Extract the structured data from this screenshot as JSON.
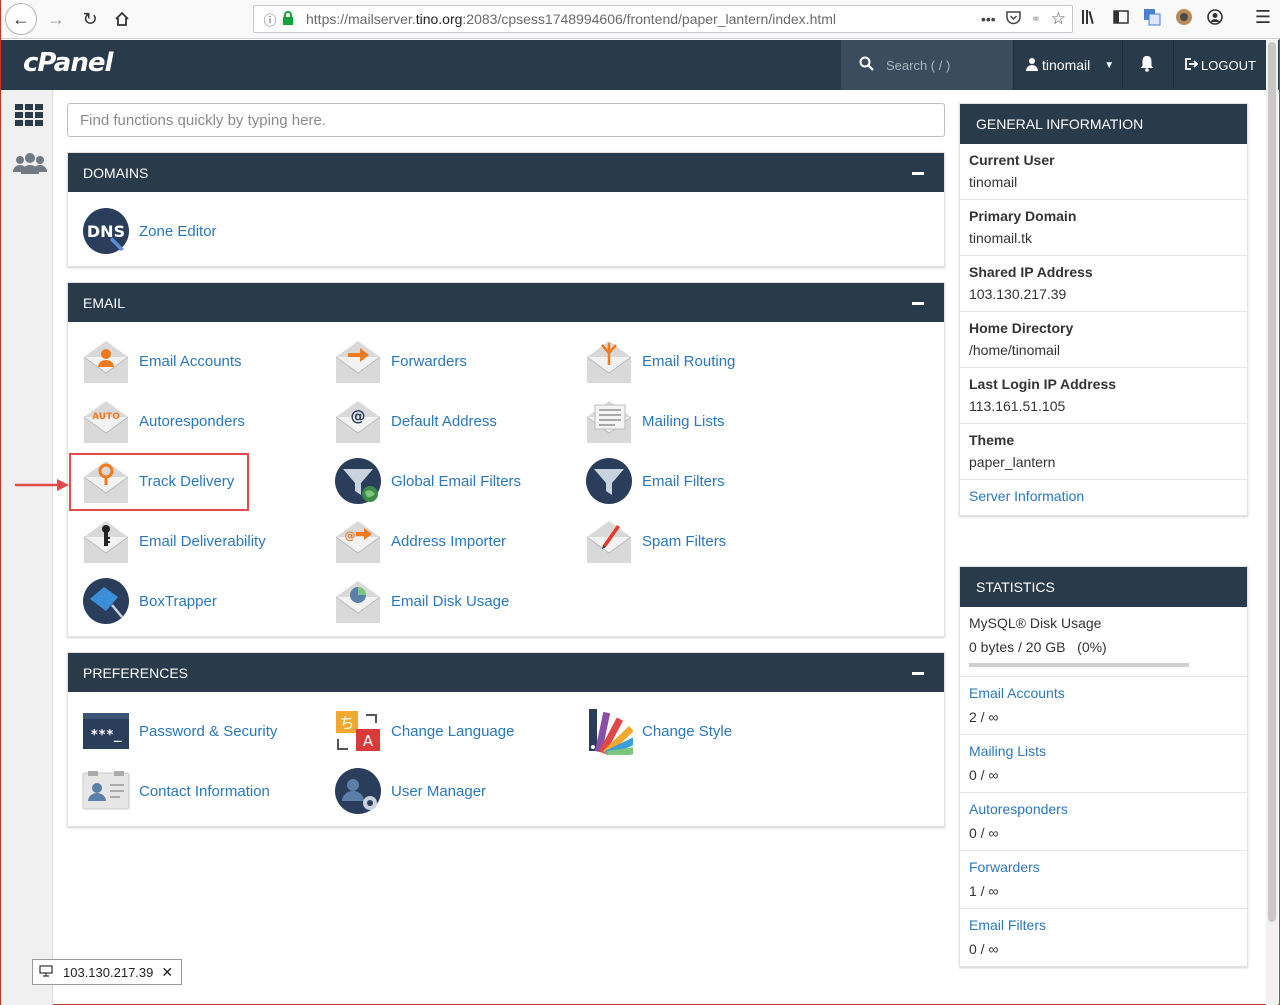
{
  "browser": {
    "url_prefix": "https://mailserver.",
    "url_host": "tino.org",
    "url_rest": ":2083/cpsess1748994606/frontend/paper_lantern/index.html",
    "dots": "•••"
  },
  "header": {
    "logo": "cPanel",
    "search_placeholder": "Search ( / )",
    "user": "tinomail",
    "logout": "LOGOUT"
  },
  "main": {
    "search_placeholder": "Find functions quickly by typing here.",
    "domains": {
      "title": "DOMAINS",
      "items": [
        {
          "label": "Zone Editor",
          "icon": "dns-icon"
        }
      ]
    },
    "email": {
      "title": "EMAIL",
      "items": [
        {
          "label": "Email Accounts",
          "icon": "email-accounts-icon"
        },
        {
          "label": "Forwarders",
          "icon": "forwarders-icon"
        },
        {
          "label": "Email Routing",
          "icon": "email-routing-icon"
        },
        {
          "label": "Autoresponders",
          "icon": "autoresponders-icon"
        },
        {
          "label": "Default Address",
          "icon": "default-address-icon"
        },
        {
          "label": "Mailing Lists",
          "icon": "mailing-lists-icon"
        },
        {
          "label": "Track Delivery",
          "icon": "track-delivery-icon"
        },
        {
          "label": "Global Email Filters",
          "icon": "global-filter-icon"
        },
        {
          "label": "Email Filters",
          "icon": "email-filter-icon"
        },
        {
          "label": "Email Deliverability",
          "icon": "email-deliverability-icon"
        },
        {
          "label": "Address Importer",
          "icon": "address-importer-icon"
        },
        {
          "label": "Spam Filters",
          "icon": "spam-filters-icon"
        },
        {
          "label": "BoxTrapper",
          "icon": "boxtrapper-icon"
        },
        {
          "label": "Email Disk Usage",
          "icon": "email-disk-usage-icon"
        }
      ],
      "auto_badge": "AUTO"
    },
    "preferences": {
      "title": "PREFERENCES",
      "items": [
        {
          "label": "Password & Security",
          "icon": "password-icon"
        },
        {
          "label": "Change Language",
          "icon": "language-icon"
        },
        {
          "label": "Change Style",
          "icon": "style-icon"
        },
        {
          "label": "Contact Information",
          "icon": "contact-icon"
        },
        {
          "label": "User Manager",
          "icon": "user-manager-icon"
        }
      ],
      "password_glyph": "***_"
    }
  },
  "general_info": {
    "title": "GENERAL INFORMATION",
    "rows": [
      {
        "k": "Current User",
        "v": "tinomail"
      },
      {
        "k": "Primary Domain",
        "v": "tinomail.tk"
      },
      {
        "k": "Shared IP Address",
        "v": "103.130.217.39"
      },
      {
        "k": "Home Directory",
        "v": "/home/tinomail"
      },
      {
        "k": "Last Login IP Address",
        "v": "113.161.51.105"
      },
      {
        "k": "Theme",
        "v": "paper_lantern"
      }
    ],
    "server_info": "Server Information"
  },
  "statistics": {
    "title": "STATISTICS",
    "mysql_label": "MySQL® Disk Usage",
    "mysql_value": "0 bytes / 20 GB   (0%)",
    "mysql_fraction": 0,
    "rows": [
      {
        "k": "Email Accounts",
        "v": "2 / ∞"
      },
      {
        "k": "Mailing Lists",
        "v": "0 / ∞"
      },
      {
        "k": "Autoresponders",
        "v": "0 / ∞"
      },
      {
        "k": "Forwarders",
        "v": "1 / ∞"
      },
      {
        "k": "Email Filters",
        "v": "0 / ∞"
      }
    ]
  },
  "status_bar": {
    "ip": "103.130.217.39"
  },
  "colors": {
    "header": "#293a4a",
    "link": "#2a77b9",
    "highlight": "#e24b4b",
    "orange": "#f07b1f"
  }
}
